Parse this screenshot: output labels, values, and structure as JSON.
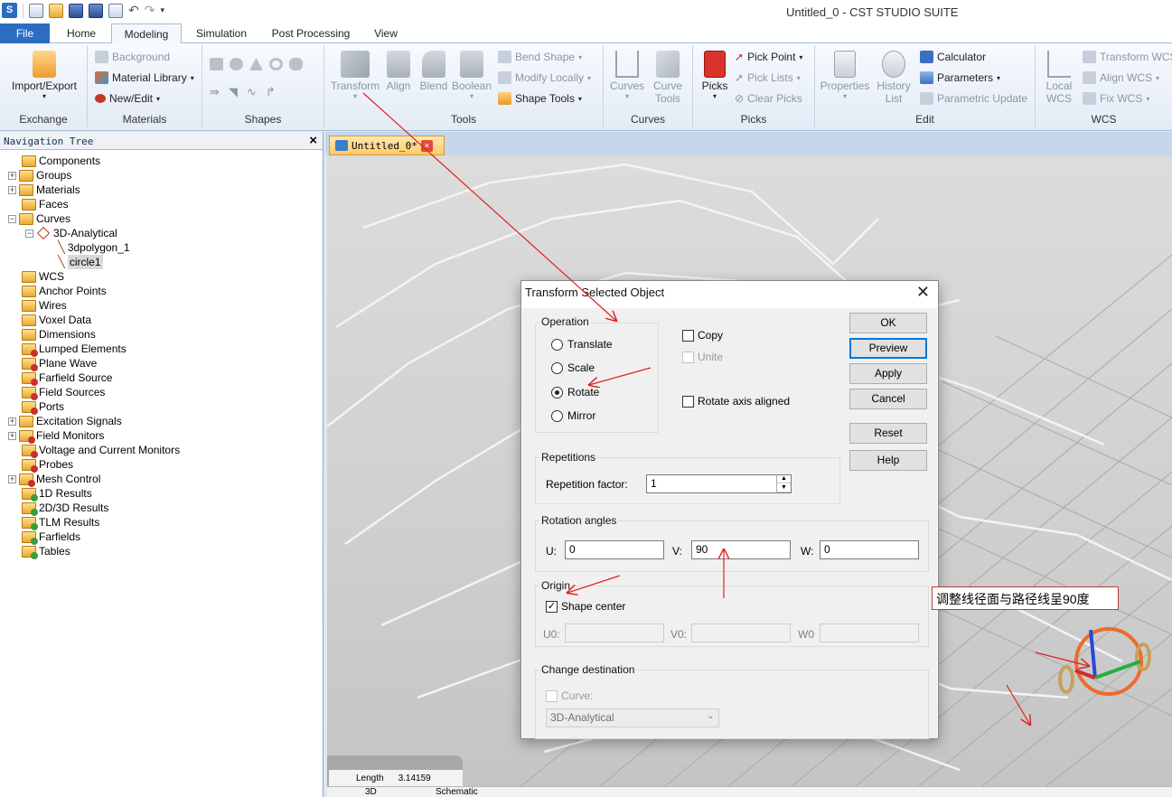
{
  "app_title": "Untitled_0 - CST STUDIO SUITE",
  "tabs": [
    "File",
    "Home",
    "Modeling",
    "Simulation",
    "Post Processing",
    "View"
  ],
  "active_tab": "Modeling",
  "ribbon": {
    "exchange": {
      "label": "Exchange",
      "import_export": "Import/Export"
    },
    "materials": {
      "label": "Materials",
      "background": "Background",
      "material_library": "Material Library",
      "new_edit": "New/Edit"
    },
    "shapes": {
      "label": "Shapes"
    },
    "tools": {
      "label": "Tools",
      "transform": "Transform",
      "align": "Align",
      "blend": "Blend",
      "boolean": "Boolean",
      "bend_shape": "Bend Shape",
      "modify_locally": "Modify Locally",
      "shape_tools": "Shape Tools"
    },
    "curves": {
      "label": "Curves",
      "curves": "Curves",
      "curve_tools_1": "Curve",
      "curve_tools_2": "Tools"
    },
    "picks": {
      "label": "Picks",
      "picks": "Picks",
      "pick_point": "Pick Point",
      "pick_lists": "Pick Lists",
      "clear_picks": "Clear Picks"
    },
    "edit": {
      "label": "Edit",
      "properties": "Properties",
      "history_1": "History",
      "history_2": "List",
      "calculator": "Calculator",
      "parameters": "Parameters",
      "parametric_update": "Parametric Update"
    },
    "wcs": {
      "label": "WCS",
      "local_1": "Local",
      "local_2": "WCS",
      "transform_wcs": "Transform WCS",
      "align_wcs": "Align WCS",
      "fix_wcs": "Fix WCS"
    }
  },
  "nav_tree": {
    "title": "Navigation Tree",
    "items": [
      {
        "label": "Components"
      },
      {
        "label": "Groups"
      },
      {
        "label": "Materials"
      },
      {
        "label": "Faces"
      },
      {
        "label": "Curves"
      },
      {
        "label": "3D-Analytical"
      },
      {
        "label": "3dpolygon_1"
      },
      {
        "label": "circle1"
      },
      {
        "label": "WCS"
      },
      {
        "label": "Anchor Points"
      },
      {
        "label": "Wires"
      },
      {
        "label": "Voxel Data"
      },
      {
        "label": "Dimensions"
      },
      {
        "label": "Lumped Elements"
      },
      {
        "label": "Plane Wave"
      },
      {
        "label": "Farfield Source"
      },
      {
        "label": "Field Sources"
      },
      {
        "label": "Ports"
      },
      {
        "label": "Excitation Signals"
      },
      {
        "label": "Field Monitors"
      },
      {
        "label": "Voltage and Current Monitors"
      },
      {
        "label": "Probes"
      },
      {
        "label": "Mesh Control"
      },
      {
        "label": "1D Results"
      },
      {
        "label": "2D/3D Results"
      },
      {
        "label": "TLM Results"
      },
      {
        "label": "Farfields"
      },
      {
        "label": "Tables"
      }
    ]
  },
  "document_tab": "Untitled_0*",
  "status": {
    "length_label": "Length",
    "length_value": "3.14159"
  },
  "view_tabs": [
    "3D",
    "Schematic"
  ],
  "dialog": {
    "title": "Transform Selected Object",
    "operation_label": "Operation",
    "operations": [
      "Translate",
      "Scale",
      "Rotate",
      "Mirror"
    ],
    "selected_operation": "Rotate",
    "copy": "Copy",
    "unite": "Unite",
    "rotate_axis_aligned": "Rotate axis aligned",
    "buttons": {
      "ok": "OK",
      "preview": "Preview",
      "apply": "Apply",
      "cancel": "Cancel",
      "reset": "Reset",
      "help": "Help"
    },
    "repetitions_label": "Repetitions",
    "repetition_factor_label": "Repetition factor:",
    "repetition_factor": "1",
    "rotation_angles_label": "Rotation angles",
    "u_label": "U:",
    "u_value": "0",
    "v_label": "V:",
    "v_value": "90",
    "w_label": "W:",
    "w_value": "0",
    "origin_label": "Origin",
    "shape_center": "Shape center",
    "shape_center_checked": true,
    "u0_label": "U0:",
    "v0_label": "V0:",
    "w0_label": "W0",
    "change_destination_label": "Change destination",
    "curve_label": "Curve:",
    "curve_value": "3D-Analytical"
  },
  "annotation": "调整线径面与路径线呈90度",
  "colors": {
    "accent": "#2c6dc2",
    "arrow": "#e02020",
    "doc_tab": "#ffc96a"
  }
}
